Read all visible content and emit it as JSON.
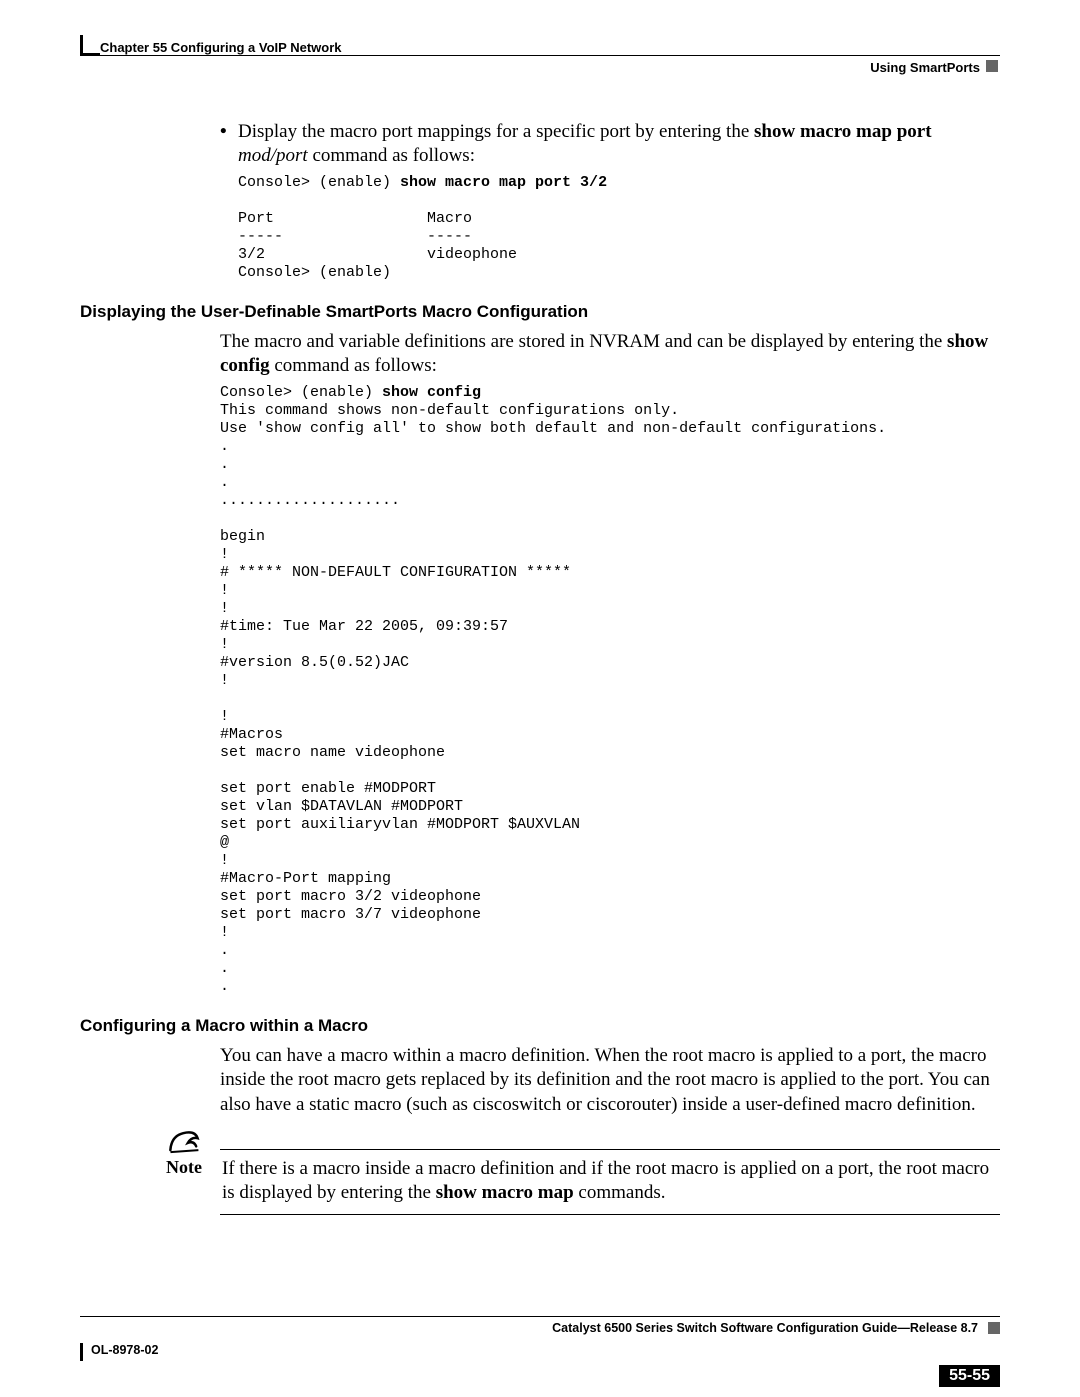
{
  "header": {
    "chapter": "Chapter 55    Configuring a VoIP Network",
    "section": "Using SmartPorts"
  },
  "bullet": {
    "lead": "Display the macro port mappings for a specific port by entering the ",
    "cmd": "show macro map port",
    "arg": " mod/port",
    "tail": " command as follows:"
  },
  "code1": {
    "l1a": "Console> (enable) ",
    "l1b": "show macro map port 3/2",
    "l2": "",
    "l3": "Port                 Macro",
    "l4": "-----                -----",
    "l5": "3/2                  videophone",
    "l6": "Console> (enable)"
  },
  "sec2": {
    "title": "Displaying the User-Definable SmartPorts Macro Configuration",
    "para_a": "The macro and variable definitions are stored in NVRAM and can be displayed by entering the ",
    "para_b": "show config",
    "para_c": " command as follows:"
  },
  "code2": {
    "l1a": "Console> (enable) ",
    "l1b": "show config",
    "rest": "This command shows non-default configurations only.\nUse 'show config all' to show both default and non-default configurations.\n.\n.\n.\n....................\n\nbegin\n!\n# ***** NON-DEFAULT CONFIGURATION *****\n!\n!\n#time: Tue Mar 22 2005, 09:39:57\n!\n#version 8.5(0.52)JAC\n!\n\n!\n#Macros\nset macro name videophone\n\nset port enable #MODPORT\nset vlan $DATAVLAN #MODPORT\nset port auxiliaryvlan #MODPORT $AUXVLAN\n@\n!\n#Macro-Port mapping\nset port macro 3/2 videophone\nset port macro 3/7 videophone\n!\n.\n.\n."
  },
  "sec3": {
    "title": "Configuring a Macro within a Macro",
    "para": "You can have a macro within a macro definition. When the root macro is applied to a port, the macro inside the root macro gets replaced by its definition and the root macro is applied to the port. You can also have a static macro (such as ciscoswitch or ciscorouter) inside a user-defined macro definition."
  },
  "note": {
    "label": "Note",
    "text_a": "If there is a macro inside a macro definition and if the root macro is applied on a port, the root macro is displayed by entering the ",
    "text_b": "show macro map",
    "text_c": " commands."
  },
  "footer": {
    "guide": "Catalyst 6500 Series Switch Software Configuration Guide—Release 8.7",
    "docnum": "OL-8978-02",
    "pagenum": "55-55"
  }
}
